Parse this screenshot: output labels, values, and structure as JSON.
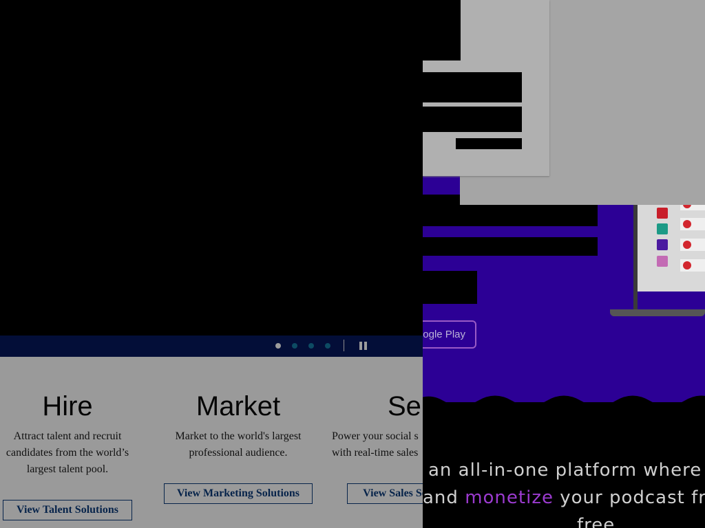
{
  "carousel": {
    "slide_count": 4,
    "active_slide": 1,
    "pause_icon": "pause-icon"
  },
  "solutions": [
    {
      "title": "Hire",
      "description_lines": [
        "Attract talent and recruit",
        "candidates from the world’s",
        "largest talent pool."
      ],
      "button": "View Talent Solutions"
    },
    {
      "title": "Market",
      "description_lines": [
        "Market to the world's largest",
        "professional audience."
      ],
      "button": "View Marketing Solutions"
    },
    {
      "title": "Sel",
      "description_lines": [
        "Power your social s",
        "with real-time sales"
      ],
      "button": "View Sales So"
    }
  ],
  "podcast_page": {
    "google_play_label": "ogle Play",
    "tagline": {
      "line1": " an all-in-one platform where",
      "line2_pre": "and ",
      "line2_accent": "monetize",
      "line2_post": " your podcast fr",
      "line3": "free"
    },
    "app_tile_colors": [
      "#c81e2a",
      "#1c9a86",
      "#4b1aa0",
      "#c36bb4"
    ]
  },
  "colors": {
    "overlay_gray": "#9a9a9a",
    "carousel_bar": "#030e38",
    "button_border": "#06234a",
    "purple_hero": "#2c0095",
    "accent_purple": "#9c3bd0"
  }
}
